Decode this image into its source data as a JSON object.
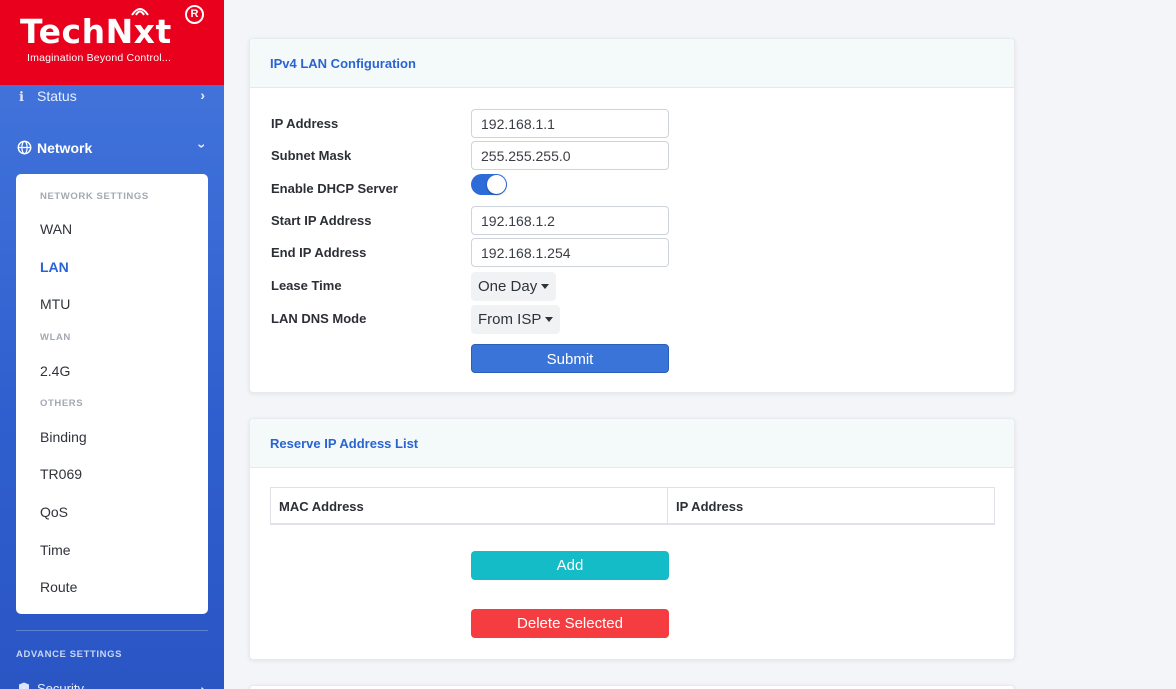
{
  "sidebar": {
    "logo_text": "TechNxt",
    "logo_reg": "R",
    "logo_tagline": "Imagination Beyond Control...",
    "status_label": "Status",
    "network_label": "Network",
    "submenu": {
      "network_settings_heading": "NETWORK SETTINGS",
      "wan": "WAN",
      "lan": "LAN",
      "mtu": "MTU",
      "wlan_heading": "WLAN",
      "g24": "2.4G",
      "others_heading": "OTHERS",
      "binding": "Binding",
      "tr069": "TR069",
      "qos": "QoS",
      "time": "Time",
      "route": "Route"
    },
    "advance_heading": "ADVANCE SETTINGS",
    "security_label": "Security"
  },
  "lan_config": {
    "title": "IPv4 LAN Configuration",
    "ip_address_label": "IP Address",
    "ip_address_value": "192.168.1.1",
    "subnet_mask_label": "Subnet Mask",
    "subnet_mask_value": "255.255.255.0",
    "dhcp_label": "Enable DHCP Server",
    "dhcp_enabled": true,
    "start_ip_label": "Start IP Address",
    "start_ip_value": "192.168.1.2",
    "end_ip_label": "End IP Address",
    "end_ip_value": "192.168.1.254",
    "lease_time_label": "Lease Time",
    "lease_time_value": "One Day",
    "dns_mode_label": "LAN DNS Mode",
    "dns_mode_value": "From ISP",
    "submit_label": "Submit"
  },
  "reserve": {
    "title": "Reserve IP Address List",
    "col_mac": "MAC Address",
    "col_ip": "IP Address",
    "add_label": "Add",
    "delete_label": "Delete Selected"
  },
  "colors": {
    "accent": "#2a63d3",
    "logo_red": "#e8001c",
    "add_button": "#14bcc7",
    "delete_button": "#f53c41"
  }
}
